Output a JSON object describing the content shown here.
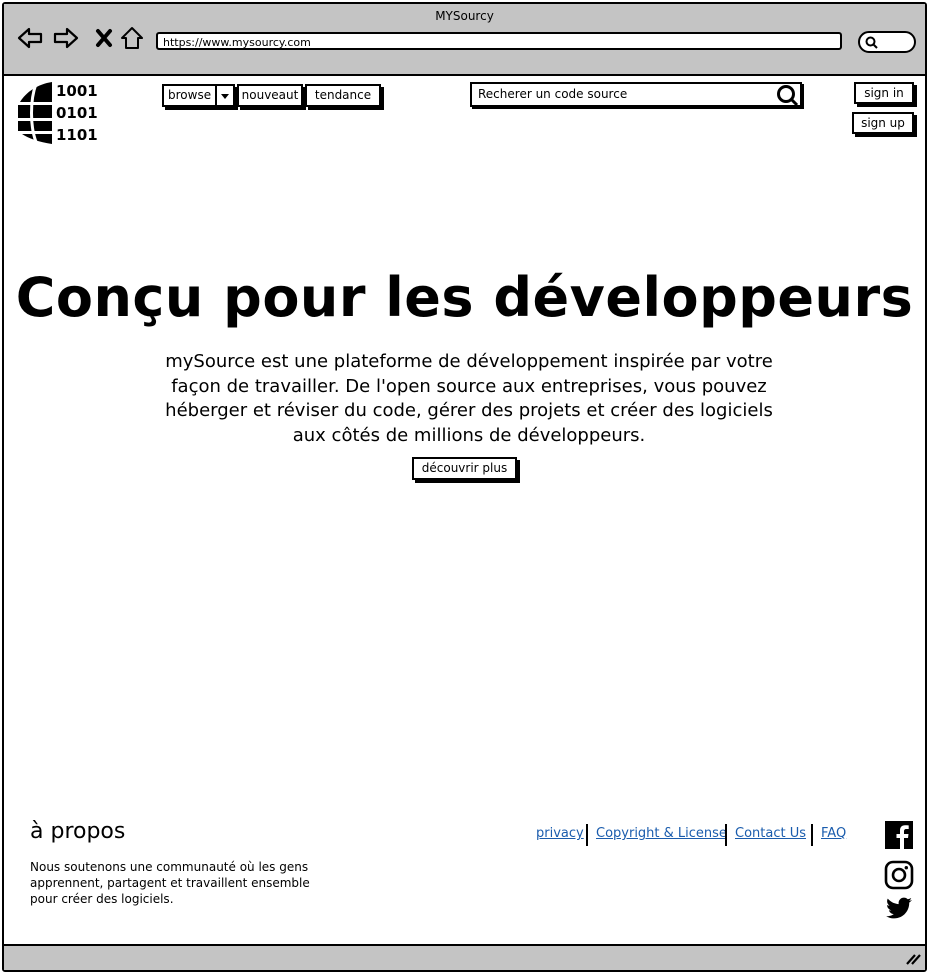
{
  "window": {
    "title": "MYSourcy"
  },
  "browser": {
    "url": "https://www.mysourcy.com"
  },
  "logo": {
    "lines": [
      "1001",
      "0101",
      "1101"
    ]
  },
  "nav": {
    "browse_label": "browse",
    "new_label": "nouveaut",
    "trending_label": "tendance"
  },
  "search": {
    "placeholder": "Recherer un  code source"
  },
  "auth": {
    "signin_label": "sign in",
    "signup_label": "sign up"
  },
  "hero": {
    "title": "Conçu pour les développeurs",
    "description": "mySource est une plateforme de développement inspirée par votre façon de travailler. De l'open source aux entreprises, vous pouvez héberger et réviser du code, gérer des projets et créer des logiciels aux côtés de millions de développeurs.",
    "cta_label": "découvrir plus"
  },
  "footer": {
    "about_title": "à propos",
    "about_text": "Nous soutenons une communauté où les gens apprennent, partagent et travaillent ensemble pour créer des logiciels.",
    "links": [
      "privacy",
      "Copyright & License",
      "Contact Us",
      "FAQ"
    ],
    "social_icons": [
      "facebook-icon",
      "instagram-icon",
      "twitter-icon"
    ]
  }
}
